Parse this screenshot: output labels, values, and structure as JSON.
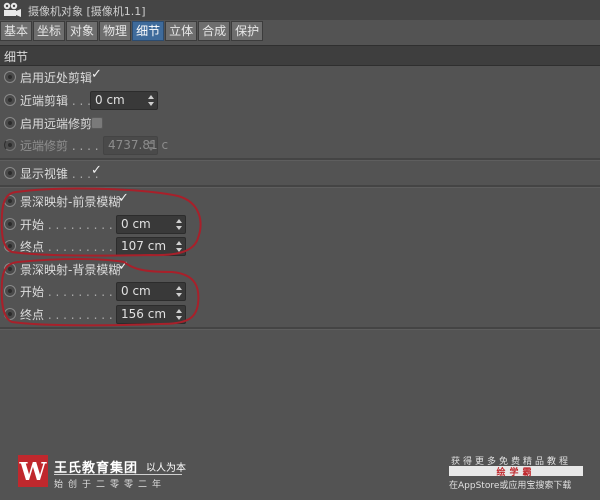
{
  "window": {
    "title": "摄像机对象 [摄像机1.1]",
    "icon": "camera-object-icon"
  },
  "tabs": [
    {
      "label": "基本",
      "active": false
    },
    {
      "label": "坐标",
      "active": false
    },
    {
      "label": "对象",
      "active": false
    },
    {
      "label": "物理",
      "active": false
    },
    {
      "label": "细节",
      "active": true
    },
    {
      "label": "立体",
      "active": false
    },
    {
      "label": "合成",
      "active": false
    },
    {
      "label": "保护",
      "active": false
    }
  ],
  "section": {
    "title": "细节"
  },
  "params": {
    "near_clip_enable": {
      "label": "启用近处剪辑",
      "checked": true
    },
    "near_clip": {
      "label": "近端剪辑",
      "dots": " . . . .",
      "value": "0 cm"
    },
    "far_clip_enable": {
      "label": "启用远端修剪",
      "checked": false
    },
    "far_clip": {
      "label": "远端修剪",
      "dots": " . . . .",
      "value": "4737.81 c"
    },
    "show_cone": {
      "label": "显示视锥",
      "dots": " . . . .",
      "checked": true
    },
    "dof_front": {
      "label": "景深映射-前景模糊",
      "checked": true
    },
    "front_start": {
      "label": "开始",
      "dots": " . . . . . . . . . . . .",
      "value": "0 cm"
    },
    "front_end": {
      "label": "终点",
      "dots": " . . . . . . . . . . . .",
      "value": "107 cm"
    },
    "dof_back": {
      "label": "景深映射-背景模糊",
      "checked": true
    },
    "back_start": {
      "label": "开始",
      "dots": " . . . . . . . . . . . .",
      "value": "0 cm"
    },
    "back_end": {
      "label": "终点",
      "dots": " . . . . . . . . . . . .",
      "value": "156 cm"
    }
  },
  "glyphs": {
    "check": "✓"
  },
  "annotation_color": "#a8202a",
  "watermark": {
    "logo_letter": "W",
    "brand_name": "王氏教育集团",
    "slogan": "以人为本",
    "since": "始创于二零零二年",
    "promo_top": "获得更多免费精品教程",
    "promo_name": "绘学霸",
    "promo_bottom": "在AppStore或应用宝搜索下载"
  }
}
